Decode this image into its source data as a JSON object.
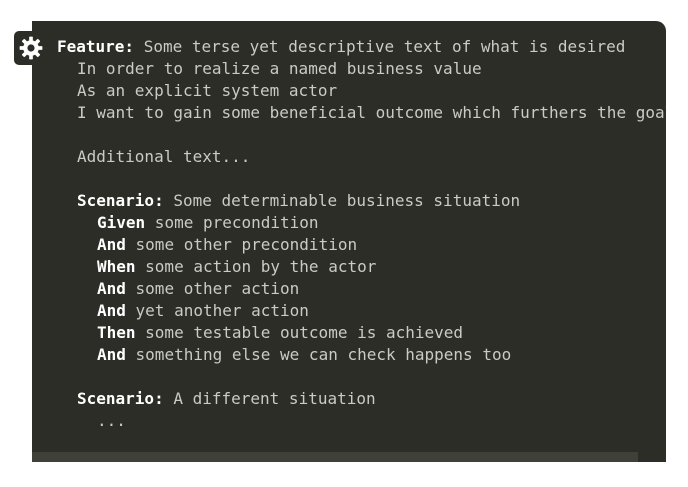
{
  "code": {
    "lines": [
      {
        "keyword": "Feature:",
        "text": " Some terse yet descriptive text of what is desired"
      },
      {
        "keyword": "",
        "text": "In order to realize a named business value"
      },
      {
        "keyword": "",
        "text": "As an explicit system actor"
      },
      {
        "keyword": "",
        "text": "I want to gain some beneficial outcome which furthers the goal"
      },
      {
        "keyword": "",
        "text": ""
      },
      {
        "keyword": "",
        "text": "Additional text..."
      },
      {
        "keyword": "",
        "text": ""
      },
      {
        "keyword": "Scenario:",
        "text": " Some determinable business situation"
      },
      {
        "keyword": "Given",
        "text": " some precondition"
      },
      {
        "keyword": "And",
        "text": " some other precondition"
      },
      {
        "keyword": "When",
        "text": " some action by the actor"
      },
      {
        "keyword": "And",
        "text": " some other action"
      },
      {
        "keyword": "And",
        "text": " yet another action"
      },
      {
        "keyword": "Then",
        "text": " some testable outcome is achieved"
      },
      {
        "keyword": "And",
        "text": " something else we can check happens too"
      },
      {
        "keyword": "",
        "text": ""
      },
      {
        "keyword": "Scenario:",
        "text": " A different situation"
      },
      {
        "keyword": "",
        "text": "..."
      }
    ]
  },
  "settings_icon": "gear-icon",
  "colors": {
    "panel_bg": "#2b2d26",
    "text": "#c9cbc4",
    "keyword": "#ffffff",
    "scrollbar_thumb": "#3f4139"
  }
}
